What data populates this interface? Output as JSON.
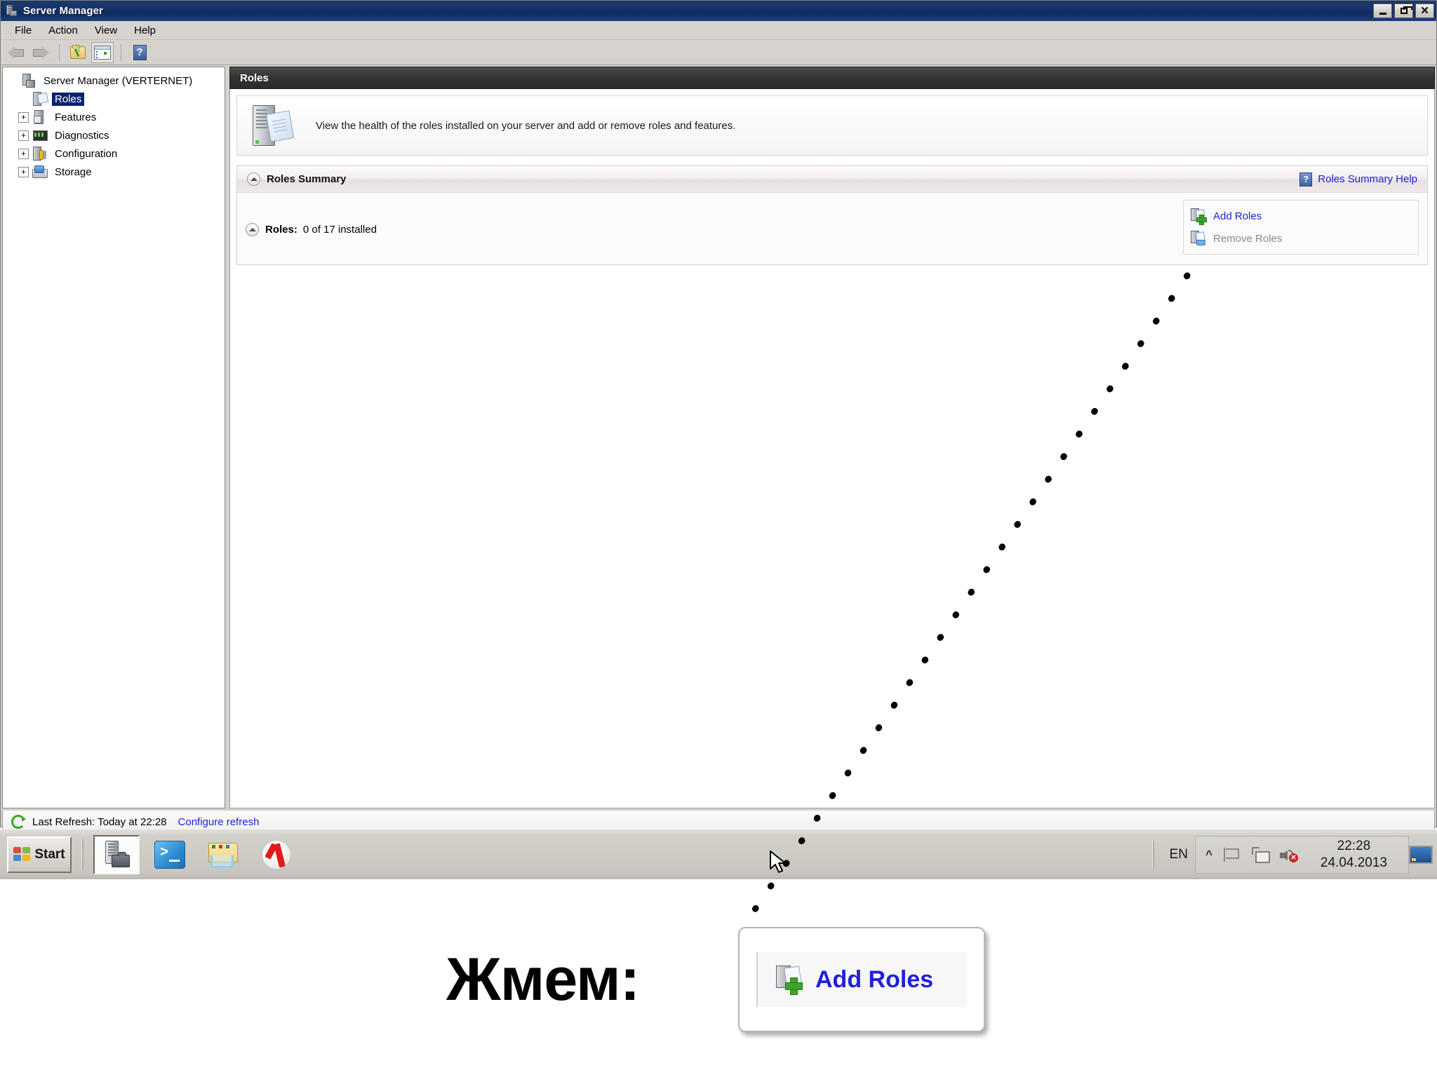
{
  "window": {
    "title": "Server Manager",
    "icon": "server-manager-icon",
    "controls": {
      "minimize": "_",
      "restore": "restore",
      "close": "×"
    }
  },
  "menu": {
    "items": [
      "File",
      "Action",
      "View",
      "Help"
    ]
  },
  "toolbar": {
    "items": [
      {
        "name": "back-button",
        "icon": "arrow-left-icon"
      },
      {
        "name": "forward-button",
        "icon": "arrow-right-icon"
      },
      {
        "name": "show-hide-console-tree-button",
        "icon": "folder-up-icon"
      },
      {
        "name": "properties-button",
        "icon": "properties-pane-icon"
      },
      {
        "name": "help-button",
        "icon": "question-mark-icon",
        "glyph": "?"
      }
    ]
  },
  "tree": {
    "items": [
      {
        "label": "Server Manager (VERTERNET)",
        "icon": "server-icon",
        "expander": "",
        "selected": false,
        "indent": false
      },
      {
        "label": "Roles",
        "icon": "roles-icon",
        "expander": "",
        "selected": true,
        "indent": true
      },
      {
        "label": "Features",
        "icon": "features-icon",
        "expander": "+",
        "selected": false,
        "indent": true
      },
      {
        "label": "Diagnostics",
        "icon": "diagnostics-icon",
        "expander": "+",
        "selected": false,
        "indent": true
      },
      {
        "label": "Configuration",
        "icon": "configuration-icon",
        "expander": "+",
        "selected": false,
        "indent": true
      },
      {
        "label": "Storage",
        "icon": "storage-icon",
        "expander": "+",
        "selected": false,
        "indent": true
      }
    ]
  },
  "content": {
    "header": "Roles",
    "intro": "View the health of the roles installed on your server and add or remove roles and features.",
    "section": {
      "title": "Roles Summary",
      "help_link": "Roles Summary Help",
      "roles_label": "Roles:",
      "roles_count": "0 of 17 installed",
      "actions": [
        {
          "label": "Add Roles",
          "icon": "add-roles-icon",
          "enabled": true
        },
        {
          "label": "Remove Roles",
          "icon": "remove-roles-icon",
          "enabled": false
        }
      ]
    }
  },
  "refresh_bar": {
    "text": "Last Refresh: Today at 22:28",
    "link": "Configure refresh"
  },
  "status_bar": {
    "panes": [
      "",
      "",
      "",
      ""
    ]
  },
  "taskbar": {
    "start_label": "Start",
    "buttons": [
      {
        "name": "taskbar-server-manager",
        "icon": "server-manager-icon",
        "active": true
      },
      {
        "name": "taskbar-powershell",
        "icon": "powershell-icon",
        "active": false
      },
      {
        "name": "taskbar-explorer",
        "icon": "windows-explorer-icon",
        "active": false
      },
      {
        "name": "taskbar-yandex-browser",
        "icon": "yandex-browser-icon",
        "active": false
      }
    ],
    "tray": {
      "language": "EN",
      "chevron": "»",
      "icons": [
        "flag-action-center-icon",
        "network-icon",
        "volume-muted-icon"
      ],
      "clock_time": "22:28",
      "clock_date": "24.04.2013",
      "show_desktop": "show-desktop-button"
    }
  },
  "annotation": {
    "text": "Жмем:",
    "callout_label": "Add Roles",
    "callout_icon": "add-roles-icon",
    "leader": "dotted-arrow-line"
  },
  "colors": {
    "titlebar": "#15336b",
    "link": "#2121d6",
    "selection": "#0a246a",
    "content_header": "#333333",
    "chrome": "#d6d3ce"
  }
}
